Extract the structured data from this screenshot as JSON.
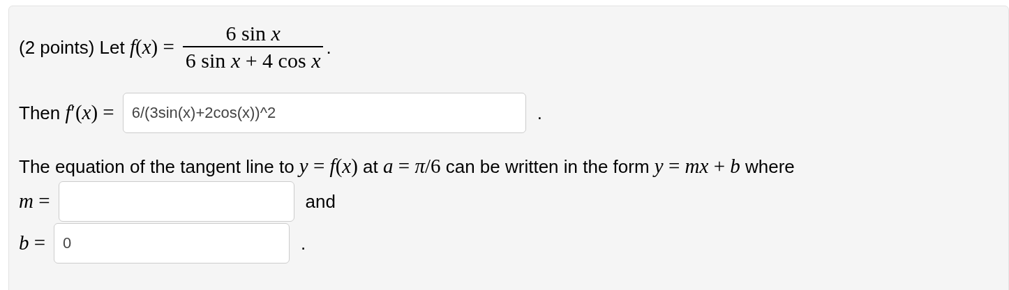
{
  "problem": {
    "lead": [
      {
        "kind": "text",
        "s": "(2 points) Let "
      },
      {
        "kind": "math",
        "s": "*f*(*x*) ="
      }
    ],
    "numerator": "6 sin *x*",
    "denominator": "6 sin *x* + 4 cos *x*",
    "end": "."
  },
  "derivative": {
    "lead": [
      {
        "kind": "text",
        "s": "Then "
      },
      {
        "kind": "math",
        "s": "*f*′(*x*) ="
      }
    ],
    "value": "6/(3sin(x)+2cos(x))^2",
    "end": "."
  },
  "tangent": {
    "sentence": [
      {
        "kind": "text",
        "s": "The equation of the tangent line to "
      },
      {
        "kind": "math",
        "s": "*y* = *f*(*x*)"
      },
      {
        "kind": "text",
        "s": " at "
      },
      {
        "kind": "math",
        "s": "*a* = *π*/6"
      },
      {
        "kind": "text",
        "s": " can be written in the form "
      },
      {
        "kind": "math",
        "s": "*y* = *mx* + *b*"
      },
      {
        "kind": "text",
        "s": " where"
      }
    ],
    "m": {
      "label": "*m* =",
      "after": "and"
    },
    "b": {
      "label": "*b* =",
      "value": "0",
      "after": "."
    }
  }
}
